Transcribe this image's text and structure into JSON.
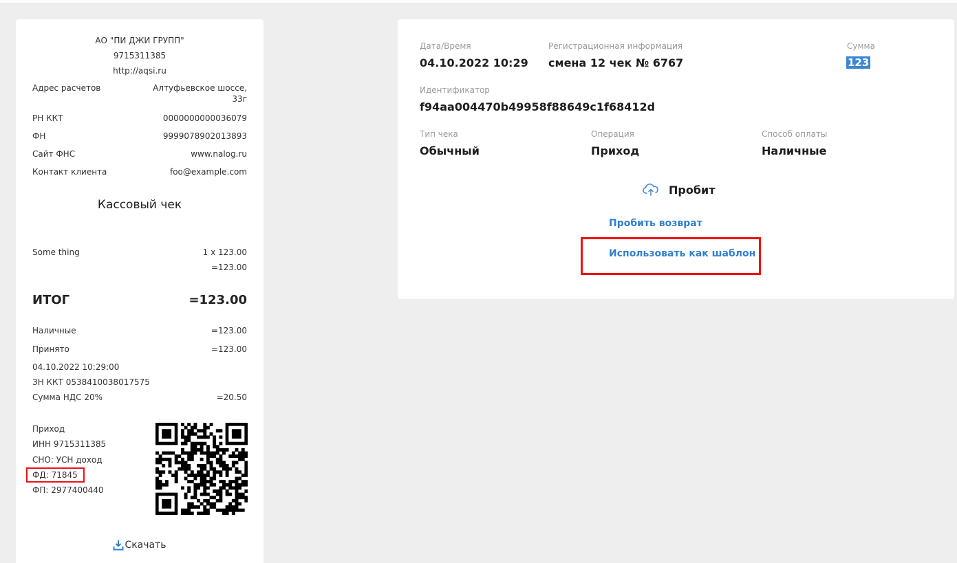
{
  "receipt": {
    "company": "АО \"ПИ ДЖИ ГРУПП\"",
    "inn_top": "9715311385",
    "site": "http://aqsi.ru",
    "fields": [
      {
        "label": "Адрес расчетов",
        "value_line1": "Алтуфьевское шоссе,",
        "value_line2": "33г"
      },
      {
        "label": "РН ККТ",
        "value": "0000000000036079"
      },
      {
        "label": "ФН",
        "value": "9999078902013893"
      },
      {
        "label": "Сайт ФНС",
        "value": "www.nalog.ru"
      },
      {
        "label": "Контакт клиента",
        "value": "foo@example.com"
      }
    ],
    "title": "Кассовый чек",
    "item": {
      "name": "Some thing",
      "qty_price": "1 x 123.00",
      "sum": "=123.00"
    },
    "total": {
      "label": "ИТОГ",
      "value": "=123.00"
    },
    "payments": [
      {
        "label": "Наличные",
        "value": "=123.00"
      },
      {
        "label": "Принято",
        "value": "=123.00"
      }
    ],
    "datetime": "04.10.2022 10:29:00",
    "zn": "ЗН ККТ 0538410038017575",
    "vat": {
      "label": "Сумма НДС 20%",
      "value": "=20.50"
    },
    "footer": [
      "Приход",
      "ИНН 9715311385",
      "СНО: УСН доход",
      "ФД: 71845",
      "ФП: 2977400440"
    ],
    "download_label": "Скачать"
  },
  "info": {
    "datetime_label": "Дата/Время",
    "datetime_value": "04.10.2022 10:29",
    "reg_label": "Регистрационная информация",
    "reg_value": "смена 12 чек № 6767",
    "sum_label": "Сумма",
    "sum_value": "123",
    "id_label": "Идентификатор",
    "id_value": "f94aa004470b49958f88649c1f68412d",
    "type_label": "Тип чека",
    "type_value": "Обычный",
    "op_label": "Операция",
    "op_value": "Приход",
    "pay_label": "Способ оплаты",
    "pay_value": "Наличные",
    "status": "Пробит",
    "refund_link": "Пробить возврат",
    "template_link": "Использовать как шаблон"
  },
  "colors": {
    "accent": "#2f7fd0",
    "highlight": "#e11111",
    "selection": "#3b86d6"
  },
  "icons": {
    "status": "cloud-upload-icon",
    "download": "download-icon",
    "qr": "qr-code"
  }
}
